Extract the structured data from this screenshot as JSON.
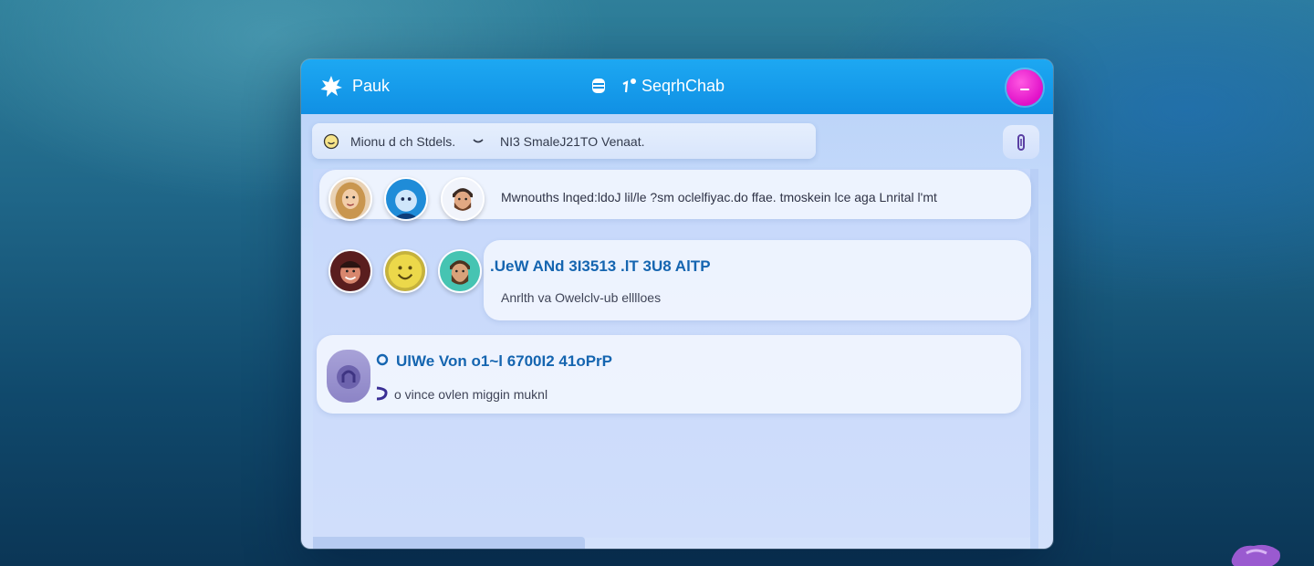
{
  "titlebar": {
    "app_name": "Pauk",
    "title": "SeqrhChab"
  },
  "search": {
    "status_label": "Mionu d ch Stdels.",
    "value": "NI3 SmaleJ21TO Venaat."
  },
  "conversations": [
    {
      "text": "Mwnouths lnqed:ldoJ lil/le ?sm oclelfiyac.do ffae. tmoskein lce aga  Lnrital l'mt",
      "avatars": [
        "blonde-woman-avatar",
        "blue-character-avatar",
        "bearded-man-avatar"
      ]
    },
    {
      "title": ".UeW ANd 3I3513 .lT 3U8 AlTP",
      "subtitle": "Anrlth va Owelclv-ub elllloes",
      "avatars": [
        "smiling-man-avatar",
        "yellow-emoji-avatar",
        "bearded-man-teal-avatar"
      ]
    },
    {
      "title": "UlWe Von  o1~l 6700I2  41oPrP",
      "subtitle": "o vince  ovlen miggin muknl",
      "avatars": [
        "chat-bubble-icon"
      ]
    }
  ],
  "colors": {
    "titlebar": "#1090e4",
    "accent": "#1565b0",
    "profile": "#e010c8"
  }
}
